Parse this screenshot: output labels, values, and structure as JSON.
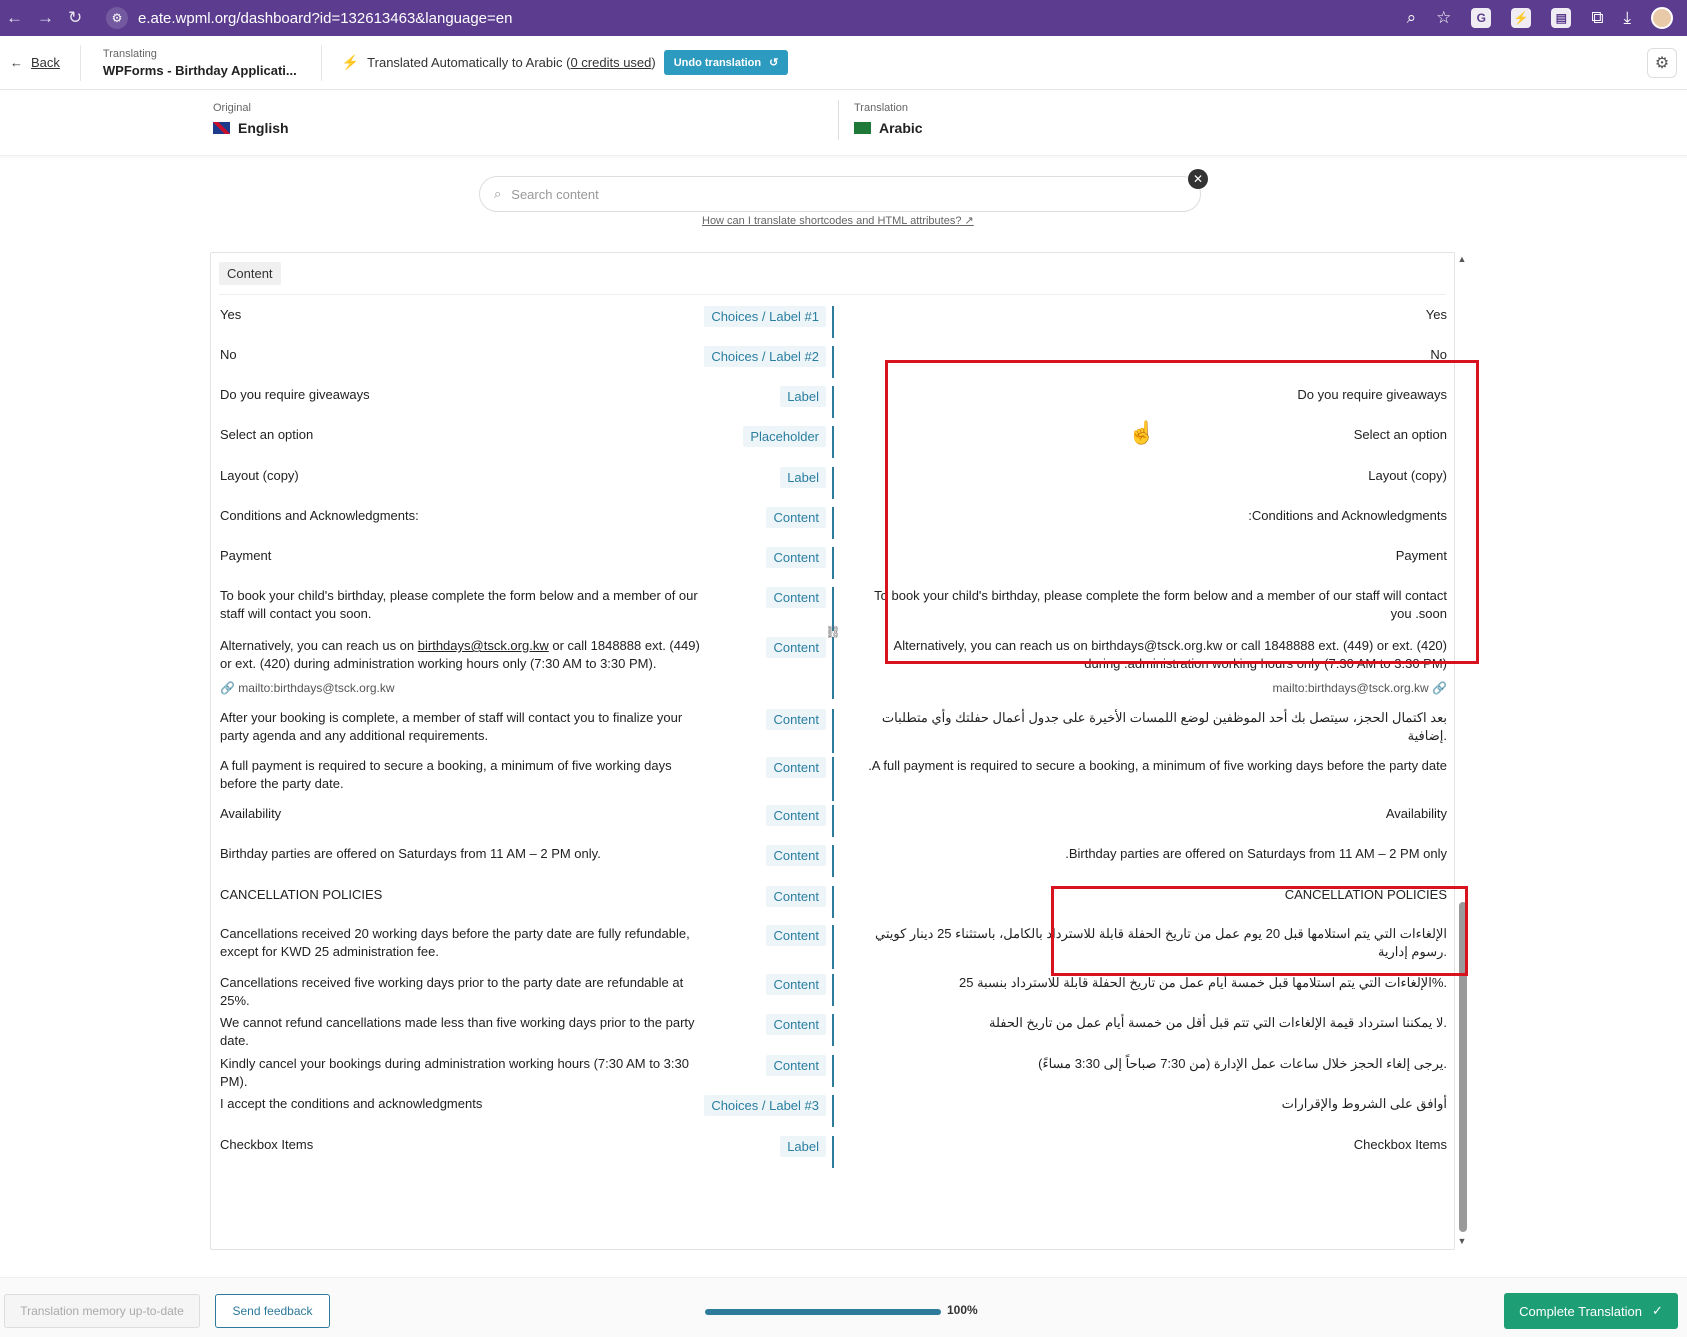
{
  "browser": {
    "url": "e.ate.wpml.org/dashboard?id=132613463&language=en"
  },
  "toolbar": {
    "back_label": "Back",
    "translating_label": "Translating",
    "doc_name": "WPForms - Birthday Applicati...",
    "auto_text_pre": "Translated Automatically to Arabic (",
    "credits_text": "0 credits used",
    "auto_text_post": ")",
    "undo_label": "Undo translation"
  },
  "languages": {
    "original_label": "Original",
    "original_name": "English",
    "translation_label": "Translation",
    "translation_name": "Arabic"
  },
  "search": {
    "placeholder": "Search content",
    "help_link": "How can I translate shortcodes and HTML attributes?"
  },
  "panel": {
    "section_label": "Content",
    "rows": [
      {
        "orig": "Yes",
        "type": "Choices / Label #1",
        "trans": "Yes"
      },
      {
        "orig": "No",
        "type": "Choices / Label #2",
        "trans": "No"
      },
      {
        "orig": "Do you require giveaways",
        "type": "Label",
        "trans": "Do you require giveaways"
      },
      {
        "orig": "Select an option",
        "type": "Placeholder",
        "trans": "Select an option"
      },
      {
        "orig": "Layout (copy)",
        "type": "Label",
        "trans": "Layout (copy)"
      },
      {
        "orig": "Conditions and Acknowledgments:",
        "type": "Content",
        "trans": ":Conditions and Acknowledgments"
      },
      {
        "orig": "Payment",
        "type": "Content",
        "trans": "Payment"
      },
      {
        "orig": "To book your child's birthday, please complete the form below and a member of our staff will contact you soon.",
        "type": "Content",
        "trans": "To book your child's birthday, please complete the form below and a member of our staff will contact you .soon"
      },
      {
        "orig_pre": "Alternatively, you can reach us on ",
        "orig_link": "birthdays@tsck.org.kw",
        "orig_post": " or call 1848888 ext. (449) or ext. (420) during administration working hours only (7:30 AM to 3:30 PM).",
        "orig_note": "mailto:birthdays@tsck.org.kw",
        "type": "Content",
        "trans": "Alternatively, you can reach us on birthdays@tsck.org.kw or call 1848888 ext. (449) or ext. (420) during .administration working hours only (7:30 AM to 3:30 PM)",
        "trans_note": "mailto:birthdays@tsck.org.kw"
      },
      {
        "orig": "After your booking is complete, a member of staff will contact you to finalize your party agenda and any additional requirements.",
        "type": "Content",
        "trans": "بعد اكتمال الحجز، سيتصل بك أحد الموظفين لوضع اللمسات الأخيرة على جدول أعمال حفلتك وأي متطلبات إضافية."
      },
      {
        "orig": "A full payment is required to secure a booking, a minimum of five working days before the party date.",
        "type": "Content",
        "trans": ".A full payment is required to secure a booking, a minimum of five working days before the party date"
      },
      {
        "orig": "Availability",
        "type": "Content",
        "trans": "Availability"
      },
      {
        "orig": "Birthday parties are offered on Saturdays from 11 AM – 2 PM only.",
        "type": "Content",
        "trans": ".Birthday parties are offered on Saturdays from 11 AM – 2 PM only"
      },
      {
        "orig": "CANCELLATION POLICIES",
        "type": "Content",
        "trans": "CANCELLATION POLICIES"
      },
      {
        "orig": "Cancellations received 20 working days before the party date are fully refundable, except for KWD 25 administration fee.",
        "type": "Content",
        "trans": "الإلغاءات التي يتم استلامها قبل 20 يوم عمل من تاريخ الحفلة قابلة للاسترداد بالكامل، باستثناء 25 دينار كويتي رسوم إدارية."
      },
      {
        "orig": "Cancellations received five working days prior to the party date are refundable at 25%.",
        "type": "Content",
        "trans": "الإلغاءات التي يتم استلامها قبل خمسة أيام عمل من تاريخ الحفلة قابلة للاسترداد بنسبة 25%."
      },
      {
        "orig": "We cannot refund cancellations made less than five working days prior to the party date.",
        "type": "Content",
        "trans": "لا يمكننا استرداد قيمة الإلغاءات التي تتم قبل أقل من خمسة أيام عمل من تاريخ الحفلة."
      },
      {
        "orig": "Kindly cancel your bookings during administration working hours (7:30 AM to 3:30 PM).",
        "type": "Content",
        "trans": "يرجى إلغاء الحجز خلال ساعات عمل الإدارة (من 7:30 صباحاً إلى 3:30 مساءً)."
      },
      {
        "orig": "I accept the conditions and acknowledgments",
        "type": "Choices / Label #3",
        "trans": "أوافق على الشروط والإقرارات"
      },
      {
        "orig": "Checkbox Items",
        "type": "Label",
        "trans": "Checkbox Items"
      }
    ]
  },
  "footer": {
    "memory_label": "Translation memory up-to-date",
    "feedback_label": "Send feedback",
    "progress_text": "100%",
    "progress_value": 1.0,
    "complete_label": "Complete Translation"
  },
  "colors": {
    "accent": "#2d7a9b",
    "highlight": "#d8121e",
    "complete": "#1e9e74",
    "browser_bar": "#5b3c8f"
  }
}
